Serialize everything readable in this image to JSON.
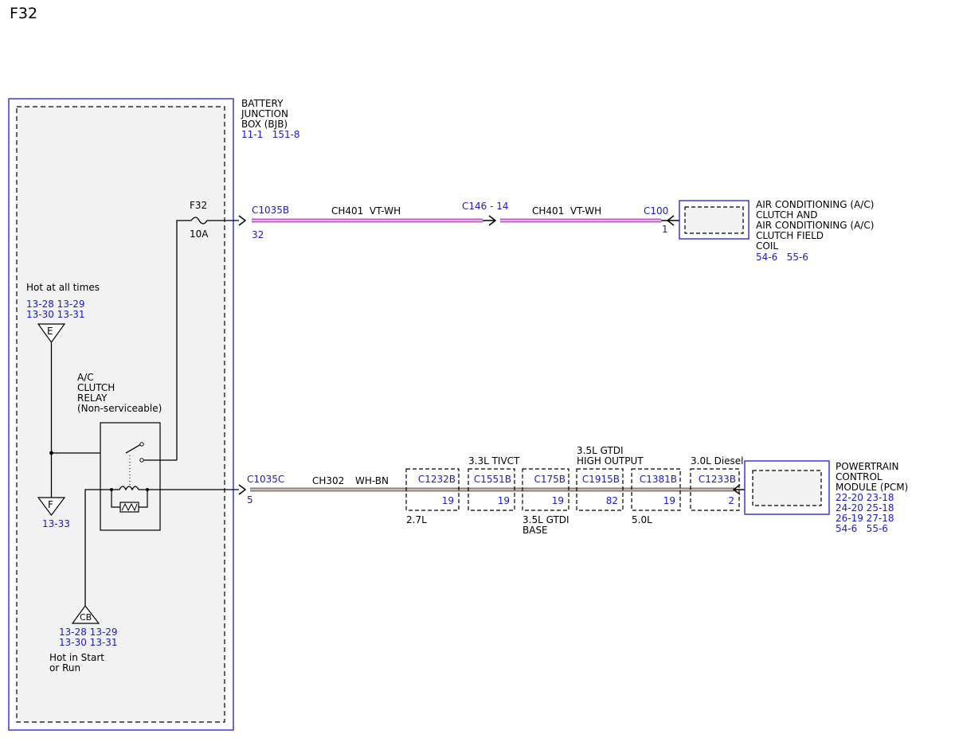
{
  "page": {
    "title": "F32"
  },
  "colors": {
    "ref_blue": "#1a1acc",
    "module_border": "#2b2bd8",
    "wire_vt_wh": "#c05ac8",
    "wire_wh_bn": "#8a7a70",
    "box_fill": "#f2f2f2"
  },
  "bjb": {
    "name_lines": [
      "BATTERY",
      "JUNCTION",
      "BOX (BJB)"
    ],
    "refs": "11-1   151-8",
    "fuse_label": "F32",
    "fuse_rating": "10A"
  },
  "power": {
    "hot_all_times_label": "Hot at all times",
    "hot_all_times_refs": [
      "13-28 13-29",
      "13-30 13-31"
    ],
    "node_e": "E",
    "node_f": "F",
    "node_f_ref": "13-33",
    "node_cb": "CB",
    "hot_start_refs": [
      "13-28 13-29",
      "13-30 13-31"
    ],
    "hot_start_label": [
      "Hot in Start",
      "or Run"
    ]
  },
  "relay": {
    "label_lines": [
      "A/C",
      "CLUTCH",
      "RELAY",
      "(Non-serviceable)"
    ]
  },
  "circuit_top": {
    "conn_start": "C1035B",
    "conn_start_pin": "32",
    "wire1_label": "CH401  VT-WH",
    "inline_conn": "C146 - 14",
    "wire2_label": "CH401  VT-WH",
    "conn_end": "C100",
    "conn_end_pin": "1"
  },
  "ac_clutch": {
    "name_lines": [
      "AIR CONDITIONING (A/C)",
      "CLUTCH AND",
      "AIR CONDITIONING (A/C)",
      "CLUTCH FIELD",
      "COIL"
    ],
    "refs": "54-6   55-6"
  },
  "circuit_bottom": {
    "conn_start": "C1035C",
    "conn_start_pin": "5",
    "wire_circuit": "CH302",
    "wire_color": "WH-BN",
    "inline_connectors": [
      {
        "name": "C1232B",
        "pin": "19",
        "variant": "2.7L",
        "variant_pos": "below"
      },
      {
        "name": "C1551B",
        "pin": "19",
        "variant": "3.3L TIVCT",
        "variant_pos": "above"
      },
      {
        "name": "C175B",
        "pin": "19",
        "variant": "3.5L GTDI\nBASE",
        "variant_pos": "below"
      },
      {
        "name": "C1915B",
        "pin": "82",
        "variant": "3.5L GTDI\nHIGH OUTPUT",
        "variant_pos": "above"
      },
      {
        "name": "C1381B",
        "pin": "19",
        "variant": "5.0L",
        "variant_pos": "below"
      },
      {
        "name": "C1233B",
        "pin": "2",
        "variant": "3.0L Diesel",
        "variant_pos": "above"
      }
    ]
  },
  "pcm": {
    "name_lines": [
      "POWERTRAIN",
      "CONTROL",
      "MODULE (PCM)"
    ],
    "refs": [
      "22-20 23-18",
      "24-20 25-18",
      "26-19 27-18",
      "54-6   55-6"
    ]
  }
}
